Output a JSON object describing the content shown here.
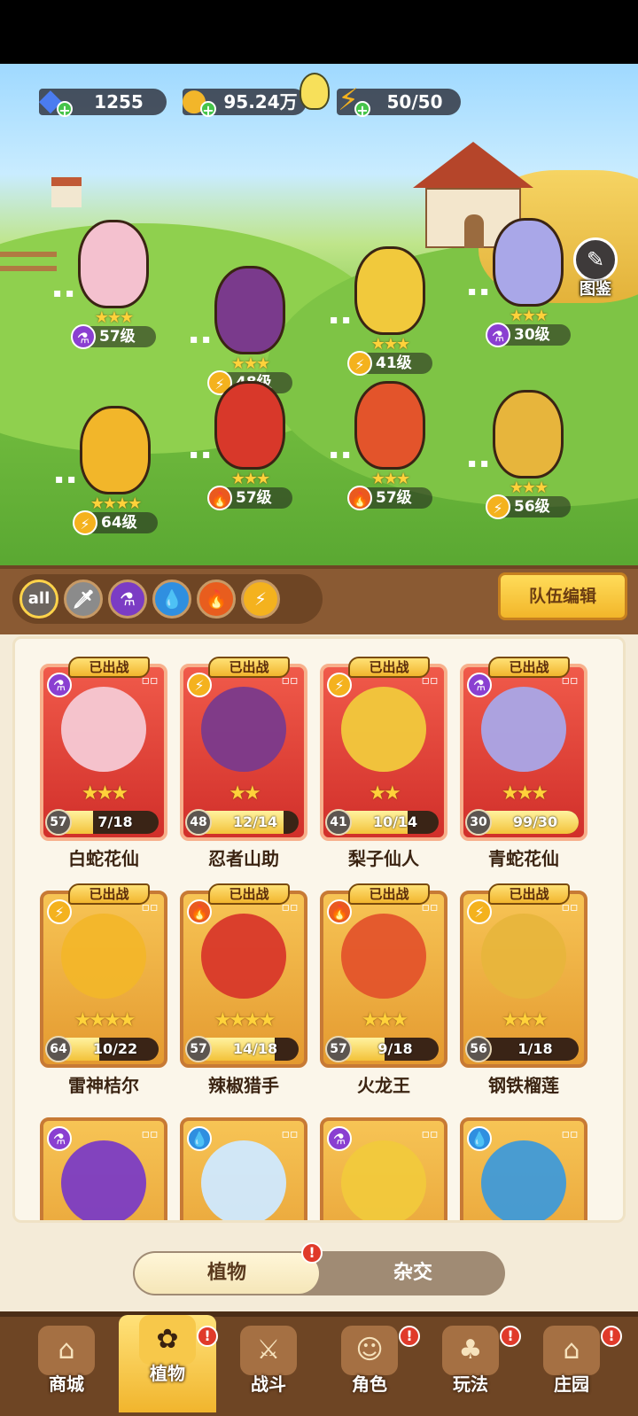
{
  "resources": {
    "gems": {
      "value": "1255",
      "icon": "diamond-icon"
    },
    "coins": {
      "value": "95.24万",
      "icon": "coin-icon"
    },
    "energy": {
      "value": "50/50",
      "icon": "lightning-icon"
    }
  },
  "codex_label": "图鉴",
  "lineup": [
    {
      "name": "白蛇花仙",
      "level": "57级",
      "stars": 3,
      "element": "purple",
      "color": "#f4c1cf"
    },
    {
      "name": "忍者山助",
      "level": "48级",
      "stars": 3,
      "element": "bolt",
      "color": "#7a3a8c"
    },
    {
      "name": "梨子仙人",
      "level": "41级",
      "stars": 3,
      "element": "bolt",
      "color": "#f1c93c"
    },
    {
      "name": "青蛇花仙",
      "level": "30级",
      "stars": 3,
      "element": "purple",
      "color": "#a9a7e8"
    },
    {
      "name": "雷神桔尔",
      "level": "64级",
      "stars": 4,
      "element": "bolt",
      "color": "#f2b62a"
    },
    {
      "name": "辣椒猎手",
      "level": "57级",
      "stars": 3,
      "element": "fire",
      "color": "#d8382a"
    },
    {
      "name": "火龙王",
      "level": "57级",
      "stars": 3,
      "element": "fire",
      "color": "#e3542b"
    },
    {
      "name": "钢铁榴莲",
      "level": "56级",
      "stars": 3,
      "element": "bolt",
      "color": "#e7b53c"
    }
  ],
  "filters": [
    "all",
    "sword",
    "purple",
    "water",
    "fire",
    "bolt"
  ],
  "team_edit_label": "队伍编辑",
  "deployed_label": "已出战",
  "cards": [
    {
      "name": "白蛇花仙",
      "level": "57",
      "progress": "7/18",
      "fill": 0.39,
      "stars": 3,
      "element": "purple",
      "style": "red",
      "art": "#f6c9d4"
    },
    {
      "name": "忍者山助",
      "level": "48",
      "progress": "12/14",
      "fill": 0.86,
      "stars": 2,
      "element": "bolt",
      "style": "red",
      "art": "#7a3a8c"
    },
    {
      "name": "梨子仙人",
      "level": "41",
      "progress": "10/14",
      "fill": 0.71,
      "stars": 2,
      "element": "bolt",
      "style": "red",
      "art": "#f1c93c"
    },
    {
      "name": "青蛇花仙",
      "level": "30",
      "progress": "99/30",
      "fill": 1.0,
      "stars": 3,
      "element": "purple",
      "style": "red",
      "art": "#a9a7e8"
    },
    {
      "name": "雷神桔尔",
      "level": "64",
      "progress": "10/22",
      "fill": 0.45,
      "stars": 4,
      "element": "bolt",
      "style": "gold",
      "art": "#f2b62a"
    },
    {
      "name": "辣椒猎手",
      "level": "57",
      "progress": "14/18",
      "fill": 0.78,
      "stars": 4,
      "element": "fire",
      "style": "gold",
      "art": "#d8382a"
    },
    {
      "name": "火龙王",
      "level": "57",
      "progress": "9/18",
      "fill": 0.5,
      "stars": 3,
      "element": "fire",
      "style": "gold",
      "art": "#e3542b"
    },
    {
      "name": "钢铁榴莲",
      "level": "56",
      "progress": "1/18",
      "fill": 0.06,
      "stars": 3,
      "element": "bolt",
      "style": "gold",
      "art": "#e7b53c"
    }
  ],
  "partial_cards": [
    {
      "element": "purple",
      "art": "#7b3cc4"
    },
    {
      "element": "water",
      "art": "#cfe9ff"
    },
    {
      "element": "purple",
      "art": "#f1c93c"
    },
    {
      "element": "water",
      "art": "#3f9ad8"
    }
  ],
  "tab_switch": {
    "selected": "植物",
    "other": "杂交",
    "notice": "!"
  },
  "nav": [
    {
      "label": "商城",
      "icon": "shop-icon",
      "glyph": "⌂",
      "notice": false
    },
    {
      "label": "植物",
      "icon": "plants-icon",
      "glyph": "✿",
      "notice": true
    },
    {
      "label": "战斗",
      "icon": "battle-icon",
      "glyph": "⚔",
      "notice": false
    },
    {
      "label": "角色",
      "icon": "character-icon",
      "glyph": "☺",
      "notice": true
    },
    {
      "label": "玩法",
      "icon": "gameplay-icon",
      "glyph": "♣",
      "notice": true
    },
    {
      "label": "庄园",
      "icon": "manor-icon",
      "glyph": "⌂",
      "notice": true
    }
  ],
  "colors": {
    "purple": "#8a3fd1",
    "bolt": "#f4b21e",
    "fire": "#ea5a1e",
    "water": "#2f8fe0"
  },
  "glyphs": {
    "purple": "⚗",
    "bolt": "⚡",
    "fire": "🔥",
    "water": "💧",
    "all": "all",
    "sword": "🗡"
  }
}
